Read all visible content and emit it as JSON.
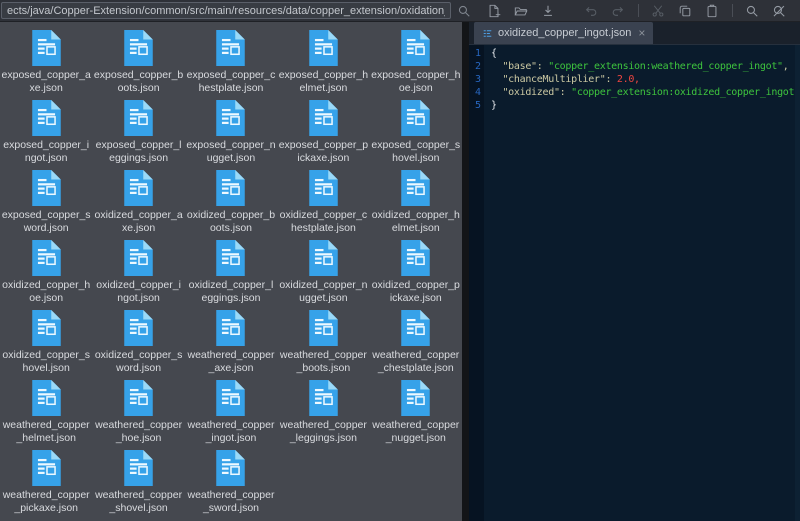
{
  "toolbar": {
    "path_value": "ects/java/Copper-Extension/common/src/main/resources/data/copper_extension/oxidation_transformation/",
    "search_icon": "search-icon",
    "buttons": [
      {
        "name": "new-file",
        "enabled": true,
        "divider_before": false,
        "gap_before": false
      },
      {
        "name": "open-folder",
        "enabled": true,
        "divider_before": false,
        "gap_before": false
      },
      {
        "name": "save",
        "enabled": true,
        "divider_before": false,
        "gap_before": false
      },
      {
        "name": "undo",
        "enabled": false,
        "divider_before": false,
        "gap_before": true
      },
      {
        "name": "redo",
        "enabled": false,
        "divider_before": false,
        "gap_before": false
      },
      {
        "name": "cut",
        "enabled": false,
        "divider_before": true,
        "gap_before": false
      },
      {
        "name": "copy",
        "enabled": true,
        "divider_before": false,
        "gap_before": false
      },
      {
        "name": "paste",
        "enabled": true,
        "divider_before": false,
        "gap_before": false
      },
      {
        "name": "find",
        "enabled": true,
        "divider_before": true,
        "gap_before": false
      },
      {
        "name": "find-replace",
        "enabled": true,
        "divider_before": false,
        "gap_before": false
      }
    ]
  },
  "file_panel": {
    "file_icon": "json-file-icon",
    "files": [
      "exposed_copper_axe.json",
      "exposed_copper_boots.json",
      "exposed_copper_chestplate.json",
      "exposed_copper_helmet.json",
      "exposed_copper_hoe.json",
      "exposed_copper_ingot.json",
      "exposed_copper_leggings.json",
      "exposed_copper_nugget.json",
      "exposed_copper_pickaxe.json",
      "exposed_copper_shovel.json",
      "exposed_copper_sword.json",
      "oxidized_copper_axe.json",
      "oxidized_copper_boots.json",
      "oxidized_copper_chestplate.json",
      "oxidized_copper_helmet.json",
      "oxidized_copper_hoe.json",
      "oxidized_copper_ingot.json",
      "oxidized_copper_leggings.json",
      "oxidized_copper_nugget.json",
      "oxidized_copper_pickaxe.json",
      "oxidized_copper_shovel.json",
      "oxidized_copper_sword.json",
      "weathered_copper_axe.json",
      "weathered_copper_boots.json",
      "weathered_copper_chestplate.json",
      "weathered_copper_helmet.json",
      "weathered_copper_hoe.json",
      "weathered_copper_ingot.json",
      "weathered_copper_leggings.json",
      "weathered_copper_nugget.json",
      "weathered_copper_pickaxe.json",
      "weathered_copper_shovel.json",
      "weathered_copper_sword.json"
    ]
  },
  "editor": {
    "tab": {
      "icon": "json-list-icon",
      "label": "oxidized_copper_ingot.json",
      "close": "×"
    },
    "lines": [
      {
        "num": "1",
        "tokens": [
          {
            "text": "{",
            "type": "punct"
          }
        ]
      },
      {
        "num": "2",
        "tokens": [
          {
            "text": "  ",
            "type": "punct"
          },
          {
            "text": "\"base\"",
            "type": "key"
          },
          {
            "text": ": ",
            "type": "key"
          },
          {
            "text": "\"copper_extension:weathered_copper_ingot\"",
            "type": "string"
          },
          {
            "text": ",",
            "type": "key"
          }
        ]
      },
      {
        "num": "3",
        "tokens": [
          {
            "text": "  ",
            "type": "punct"
          },
          {
            "text": "\"chanceMultiplier\"",
            "type": "key"
          },
          {
            "text": ": ",
            "type": "key"
          },
          {
            "text": "2.0,",
            "type": "number"
          }
        ]
      },
      {
        "num": "4",
        "tokens": [
          {
            "text": "  ",
            "type": "punct"
          },
          {
            "text": "\"oxidized\"",
            "type": "key"
          },
          {
            "text": ": ",
            "type": "key"
          },
          {
            "text": "\"copper_extension:oxidized_copper_ingot\"",
            "type": "string"
          }
        ]
      },
      {
        "num": "5",
        "tokens": [
          {
            "text": "}",
            "type": "punct"
          }
        ]
      }
    ]
  },
  "colors": {
    "file_icon_blue": "#36a2e9",
    "file_icon_fold": "#9ad9f8",
    "panel_bg": "#45484f",
    "editor_bg": "#0a1b2c",
    "gutter_bg": "#061322",
    "line_number": "#2766bf",
    "key": "#ccc9a3",
    "string": "#3ec43e",
    "number": "#ef4540",
    "toolbar_bg": "#2e3138"
  }
}
